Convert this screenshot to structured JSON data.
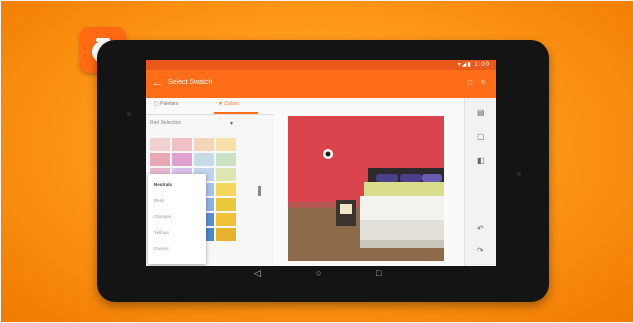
{
  "app_icon": "paint-drop-icon",
  "status_bar": {
    "icons": "▾◢▮ ",
    "time": "1:00"
  },
  "app_bar": {
    "title": "Select Swatch",
    "actions": [
      "▢",
      "↻"
    ]
  },
  "tabs": [
    {
      "label": "Palettes"
    },
    {
      "label": "Colors"
    }
  ],
  "filter": {
    "label": "Red Selection"
  },
  "dropdown": {
    "items": [
      "Neutrals",
      "Reds",
      "Oranges",
      "Yellows",
      "Greens"
    ]
  },
  "swatches": [
    "#f3cfd0",
    "#f1c0c5",
    "#f6d6b8",
    "#f8e1a9",
    "#e9a9b4",
    "#dfa2d0",
    "#c7dbe7",
    "#c9e2c2",
    "#e6b7cc",
    "#d8c0ea",
    "#c2d4ec",
    "#dbe6b0",
    "#d27a6f",
    "#c56bb0",
    "#a8c3e8",
    "#f4d55d",
    "#c04b43",
    "#d0862f",
    "#8fb1df",
    "#e7c93b",
    "#7c5aa8",
    "#8a7bbd",
    "#5d8fd0",
    "#f0c23a",
    "#3b6ab8",
    "#6b6cb3",
    "#4f86c9",
    "#e6b12c"
  ],
  "colors": {
    "accent": "#ff6d18",
    "status_bar": "#e8591a",
    "wall": "#d9444d"
  },
  "right_rail": {
    "icons": [
      "save-icon",
      "share-icon",
      "compare-icon",
      "undo-icon",
      "redo-icon"
    ]
  },
  "nav": {
    "back": "◁",
    "home": "○",
    "recents": "□"
  }
}
